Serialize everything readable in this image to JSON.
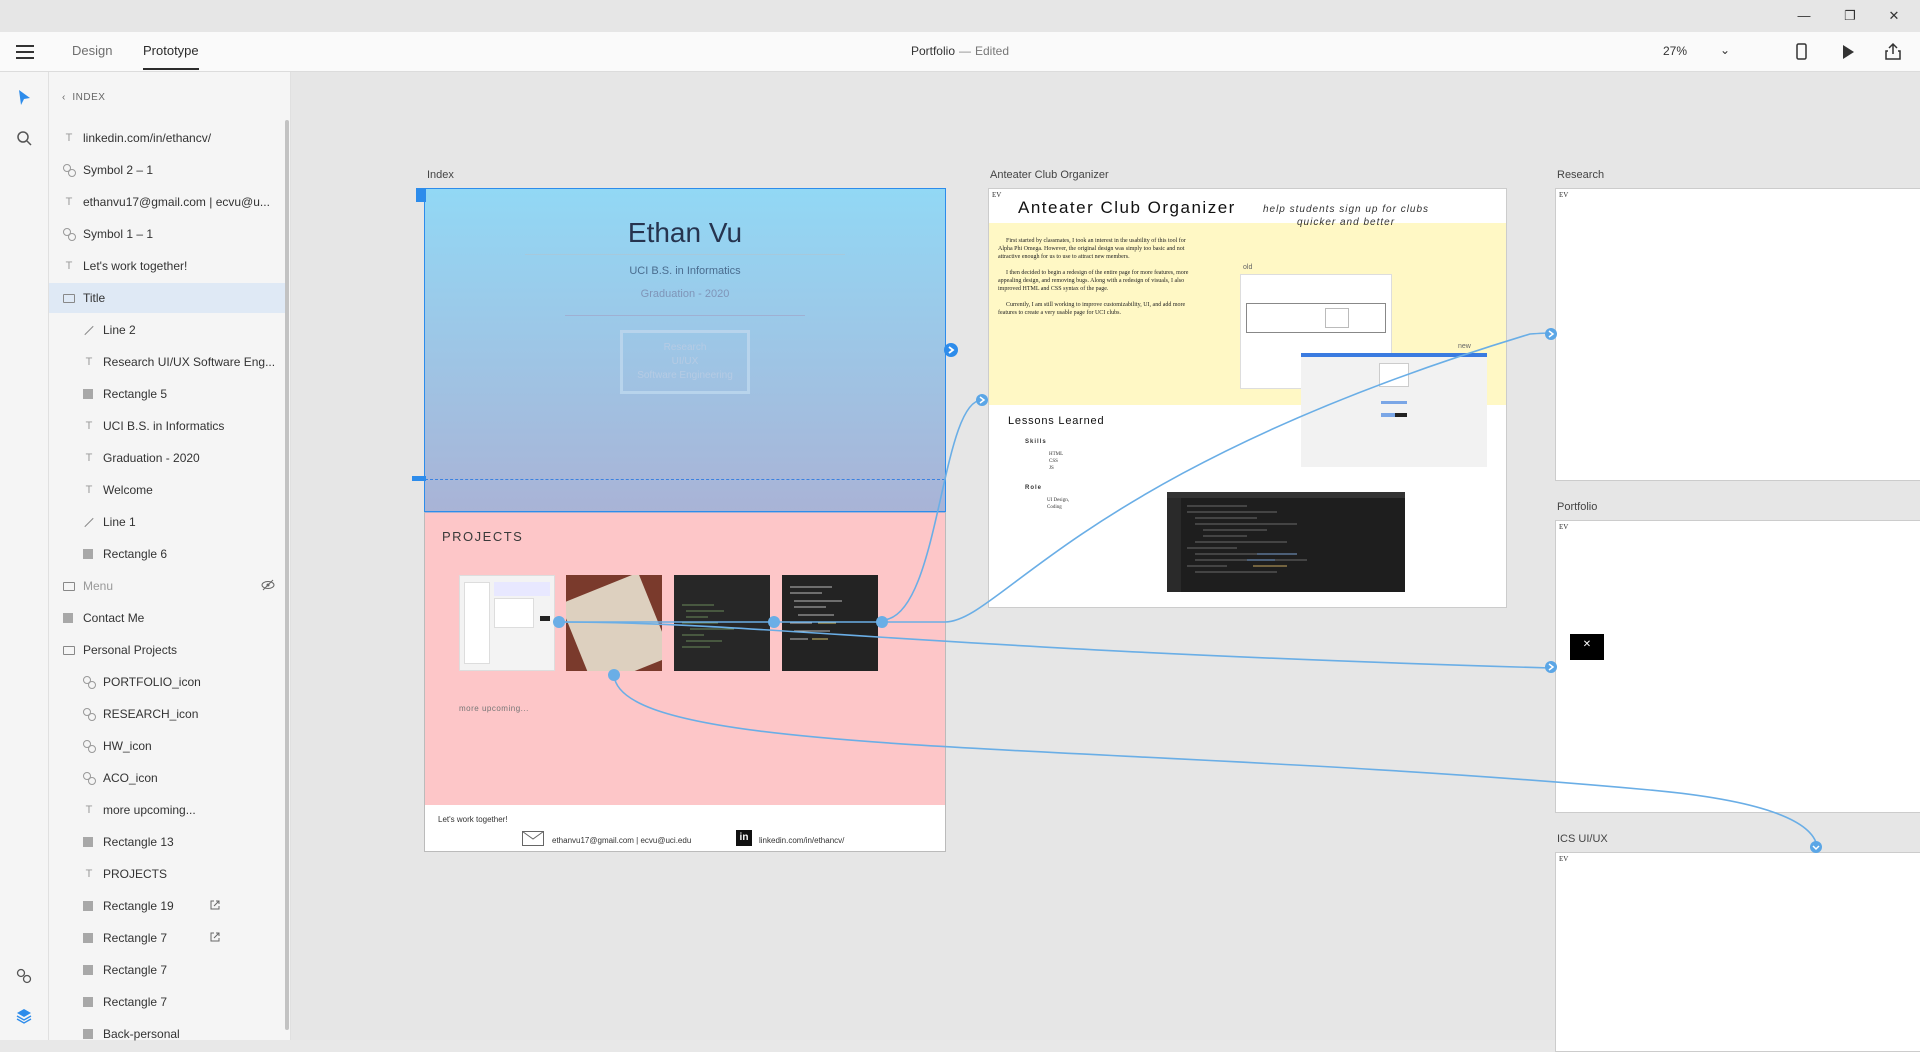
{
  "window": {
    "minimize": "—",
    "restore": "❐",
    "close": "✕"
  },
  "appbar": {
    "tabs": [
      "Design",
      "Prototype"
    ],
    "doc_name": "Portfolio",
    "separator": "—",
    "doc_status": "Edited",
    "zoom": "27%"
  },
  "layers": {
    "back_label": "INDEX",
    "items": [
      {
        "label": "linkedin.com/in/ethancv/",
        "icon": "text-icon",
        "indent": 0
      },
      {
        "label": "Symbol 2 – 1",
        "icon": "symbol-icon",
        "indent": 0
      },
      {
        "label": "ethanvu17@gmail.com | ecvu@u...",
        "icon": "text-icon",
        "indent": 0
      },
      {
        "label": "Symbol 1 – 1",
        "icon": "symbol-icon",
        "indent": 0
      },
      {
        "label": "Let's work together!",
        "icon": "text-icon",
        "indent": 0
      },
      {
        "label": "Title",
        "icon": "folder-icon",
        "indent": 0,
        "selected": true
      },
      {
        "label": "Line 2",
        "icon": "line-icon",
        "indent": 1
      },
      {
        "label": "Research UI/UX Software Eng...",
        "icon": "text-icon",
        "indent": 1
      },
      {
        "label": "Rectangle 5",
        "icon": "rect-icon",
        "indent": 1
      },
      {
        "label": "UCI B.S. in Informatics",
        "icon": "text-icon",
        "indent": 1
      },
      {
        "label": "Graduation -  2020",
        "icon": "text-icon",
        "indent": 1
      },
      {
        "label": "Welcome",
        "icon": "text-icon",
        "indent": 1
      },
      {
        "label": "Line 1",
        "icon": "line-icon",
        "indent": 1
      },
      {
        "label": "Rectangle 6",
        "icon": "rect-icon",
        "indent": 1
      },
      {
        "label": "Menu",
        "icon": "folder-icon",
        "indent": 0,
        "hidden": true
      },
      {
        "label": "Contact Me",
        "icon": "rect-icon",
        "indent": 0
      },
      {
        "label": "Personal Projects",
        "icon": "folder-icon",
        "indent": 0
      },
      {
        "label": "PORTFOLIO_icon",
        "icon": "symbol-icon",
        "indent": 1
      },
      {
        "label": "RESEARCH_icon",
        "icon": "symbol-icon",
        "indent": 1
      },
      {
        "label": "HW_icon",
        "icon": "symbol-icon",
        "indent": 1
      },
      {
        "label": "ACO_icon",
        "icon": "symbol-icon",
        "indent": 1
      },
      {
        "label": "more upcoming...",
        "icon": "text-icon",
        "indent": 1
      },
      {
        "label": "Rectangle 13",
        "icon": "rect-icon",
        "indent": 1
      },
      {
        "label": "PROJECTS",
        "icon": "text-icon",
        "indent": 1
      },
      {
        "label": "Rectangle 19",
        "icon": "rect-icon",
        "indent": 1,
        "link": true
      },
      {
        "label": "Rectangle 7",
        "icon": "rect-icon",
        "indent": 1,
        "link": true
      },
      {
        "label": "Rectangle 7",
        "icon": "rect-icon",
        "indent": 1
      },
      {
        "label": "Rectangle 7",
        "icon": "rect-icon",
        "indent": 1
      },
      {
        "label": "Back-personal",
        "icon": "rect-icon",
        "indent": 1
      }
    ]
  },
  "artboards": {
    "index": {
      "label": "Index",
      "name": "Ethan Vu",
      "degree": "UCI B.S. in Informatics",
      "graduation": "Graduation -  2020",
      "tags": [
        "Research",
        "UI/UX",
        "Software Engineering"
      ],
      "projects_heading": "PROJECTS",
      "more": "more upcoming...",
      "footer_cta": "Let's work together!",
      "email": "ethanvu17@gmail.com | ecvu@uci.edu",
      "linkedin_logo": "in",
      "linkedin": "linkedin.com/in/ethancv/"
    },
    "aco": {
      "label": "Anteater Club Organizer",
      "logo": "EV",
      "title": "Anteater Club Organizer",
      "tagline": "help students sign up for clubs quicker and better",
      "para1": "First started by classmates, I took an interest in the usability of this tool for Alpha Phi Omega. However, the original design was simply too basic and not attractive enough for us to use to attract new members.",
      "para2": "I then decided to begin a redesign of the entire page for more features, more appealing design, and removing bugs. Along with a redesign of visuals, I also improved HTML and CSS syntax of the page.",
      "para3": "Currently, I am still working to improve customizability, UI, and add more features to create a very usable page for UCI clubs.",
      "old_label": "old",
      "new_label": "new",
      "lessons": "Lessons Learned",
      "skills_head": "Skills",
      "skills": "HTML\nCSS\nJS",
      "role_head": "Role",
      "role": "UI Design,\nCoding"
    },
    "research": {
      "label": "Research",
      "logo": "EV"
    },
    "portfolio": {
      "label": "Portfolio",
      "logo": "EV",
      "close_glyph": "✕"
    },
    "ics": {
      "label": "ICS UI/UX",
      "logo": "EV"
    }
  },
  "colors": {
    "accent": "#2d8ceb",
    "wire": "#6aaee6",
    "hero_top": "#92d8f5",
    "hero_bottom": "#a9b3d6",
    "projects_bg": "#fdc6c8",
    "aco_yellow": "#fff8c5"
  }
}
